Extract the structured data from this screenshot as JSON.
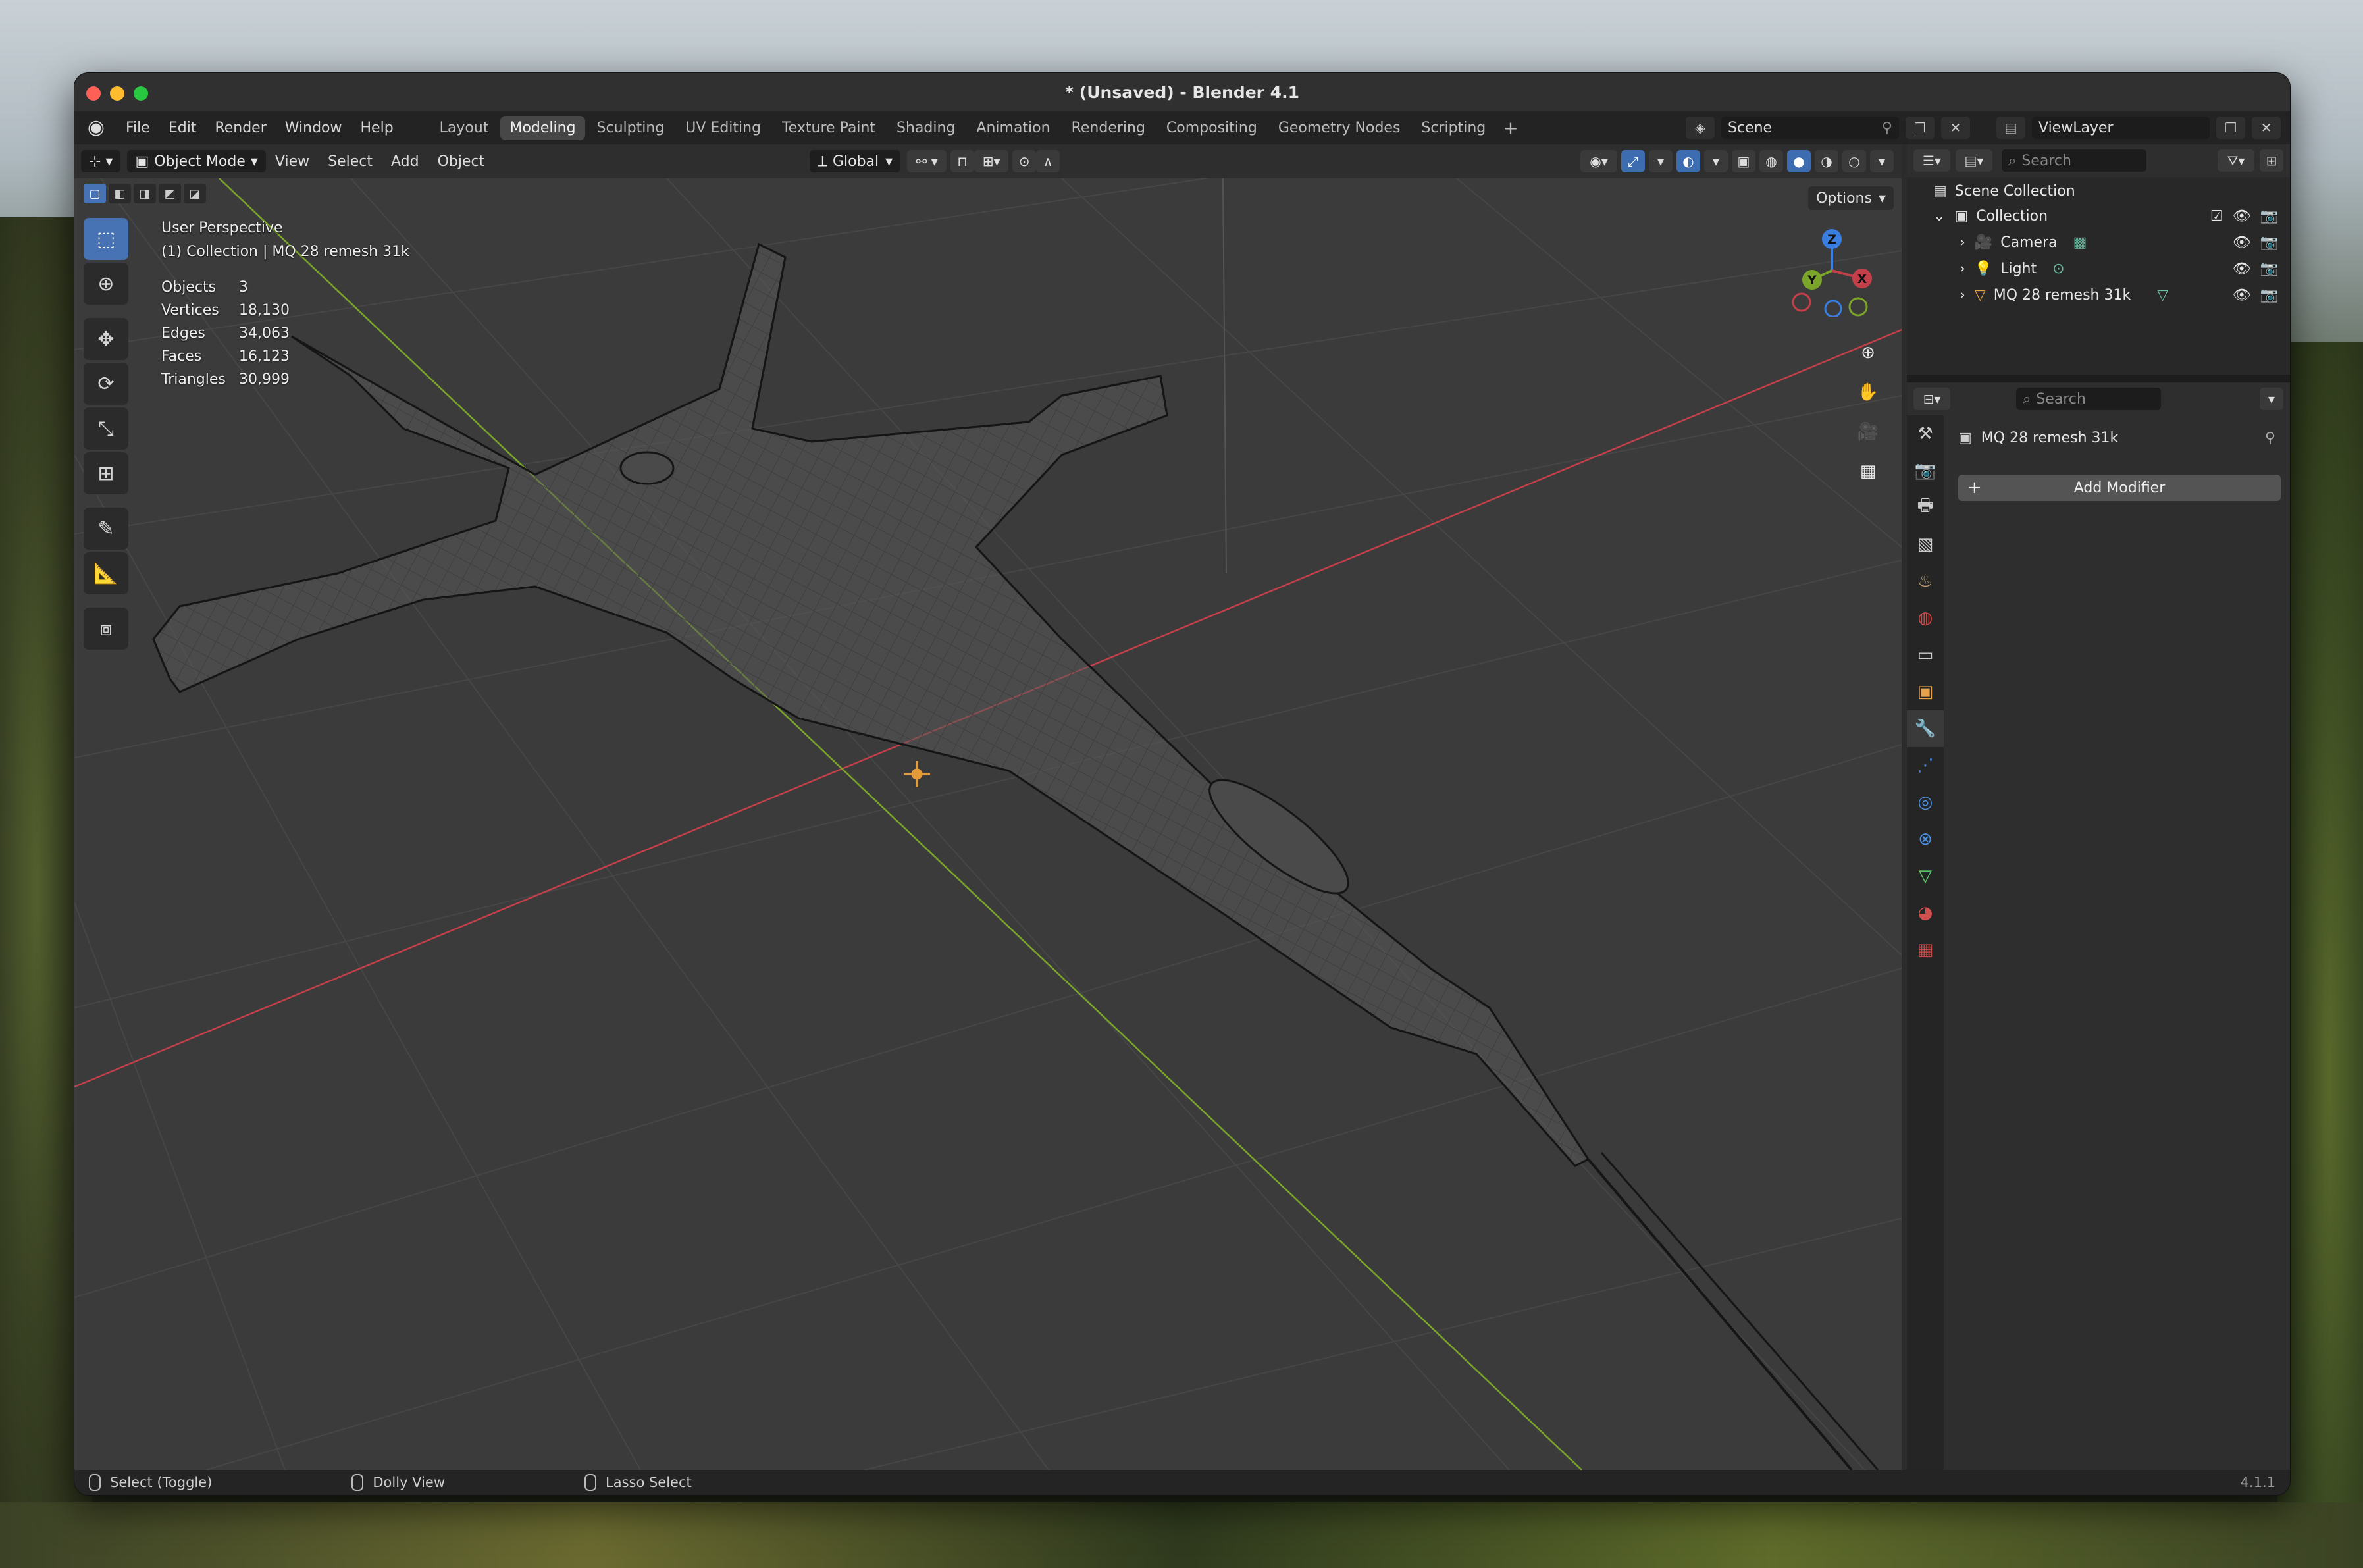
{
  "window": {
    "title": "* (Unsaved) - Blender 4.1"
  },
  "menus": [
    "File",
    "Edit",
    "Render",
    "Window",
    "Help"
  ],
  "workspaces": [
    {
      "label": "Layout",
      "active": false
    },
    {
      "label": "Modeling",
      "active": true
    },
    {
      "label": "Sculpting",
      "active": false
    },
    {
      "label": "UV Editing",
      "active": false
    },
    {
      "label": "Texture Paint",
      "active": false
    },
    {
      "label": "Shading",
      "active": false
    },
    {
      "label": "Animation",
      "active": false
    },
    {
      "label": "Rendering",
      "active": false
    },
    {
      "label": "Compositing",
      "active": false
    },
    {
      "label": "Geometry Nodes",
      "active": false
    },
    {
      "label": "Scripting",
      "active": false
    }
  ],
  "scene": {
    "name": "Scene",
    "view_layer": "ViewLayer"
  },
  "viewport_header": {
    "mode": "Object Mode",
    "menus": [
      "View",
      "Select",
      "Add",
      "Object"
    ],
    "transform_orientation": "Global",
    "options_label": "Options"
  },
  "viewport": {
    "view_name": "User Perspective",
    "collection_info": "(1) Collection | MQ 28 remesh 31k",
    "stats": [
      {
        "label": "Objects",
        "value": "3"
      },
      {
        "label": "Vertices",
        "value": "18,130"
      },
      {
        "label": "Edges",
        "value": "34,063"
      },
      {
        "label": "Faces",
        "value": "16,123"
      },
      {
        "label": "Triangles",
        "value": "30,999"
      }
    ],
    "gizmo_axes": {
      "x": "X",
      "y": "Y",
      "z": "Z"
    },
    "colors": {
      "x_axis": "#c3404a",
      "y_axis": "#7aa52a",
      "z_axis": "#3a7ee0",
      "active_tool": "#4772b3"
    }
  },
  "outliner": {
    "search_placeholder": "Search",
    "root": "Scene Collection",
    "collection": "Collection",
    "items": [
      {
        "name": "Camera",
        "icon": "camera-icon"
      },
      {
        "name": "Light",
        "icon": "light-icon"
      },
      {
        "name": "MQ 28 remesh 31k",
        "icon": "mesh-icon"
      }
    ]
  },
  "properties": {
    "search_placeholder": "Search",
    "object_name": "MQ 28 remesh 31k",
    "add_modifier_label": "Add Modifier"
  },
  "statusbar": {
    "items": [
      "Select (Toggle)",
      "Dolly View",
      "Lasso Select"
    ],
    "version": "4.1.1"
  }
}
